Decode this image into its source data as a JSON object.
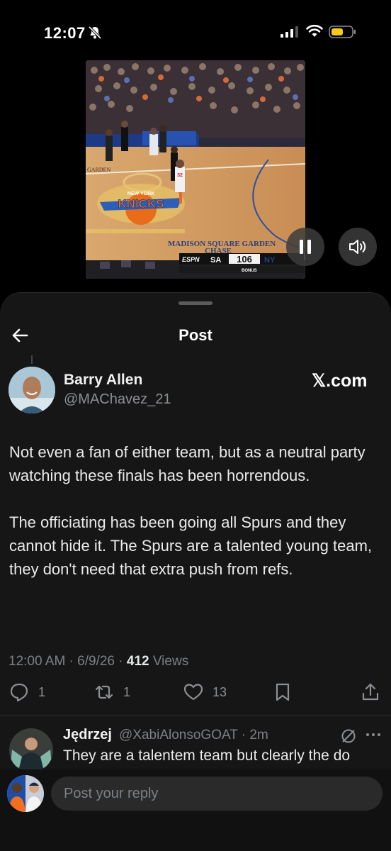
{
  "status_bar": {
    "time": "12:07",
    "icons": [
      "bell-slash-icon",
      "cellular-signal-icon",
      "wifi-icon",
      "battery-icon"
    ],
    "battery_color": "#f4c81c"
  },
  "video": {
    "scoreboard": {
      "network": "ESPN",
      "away_team": "SA",
      "score": "106",
      "home_team": "NY",
      "bonus": "BONUS"
    },
    "court_text": {
      "arena": "MADISON SQUARE GARDEN",
      "sponsor": "CHASE",
      "garden": "GARDEN",
      "team": "KNICKS",
      "team_top": "NEW YORK"
    },
    "controls": {
      "pause": "pause-icon",
      "sound": "speaker-icon"
    }
  },
  "header": {
    "title": "Post",
    "back": "arrow-left-icon"
  },
  "post": {
    "author_name": "Barry Allen",
    "author_handle": "@MAChavez_21",
    "source": "𝕏.com",
    "paragraphs": [
      "Not even a fan of either team, but as a neutral party watching these finals has been horrendous.",
      "The officiating has been going all Spurs and they cannot hide it. The Spurs are a talented young team, they don't need that extra push from refs."
    ],
    "timestamp": "12:00 AM · 6/9/26 · ",
    "views_count": "412",
    "views_label": " Views",
    "actions": {
      "replies": "1",
      "reposts": "1",
      "likes": "13"
    }
  },
  "reply": {
    "name": "Jędrzej",
    "handle": "@XabiAlonsoGOAT · 2m",
    "text": "They are a talentem team but clearly the do"
  },
  "composer": {
    "placeholder": "Post your reply"
  },
  "colors": {
    "background": "#000000",
    "sheet": "#161616",
    "muted": "#7c8085",
    "text": "#e7e9ea"
  }
}
